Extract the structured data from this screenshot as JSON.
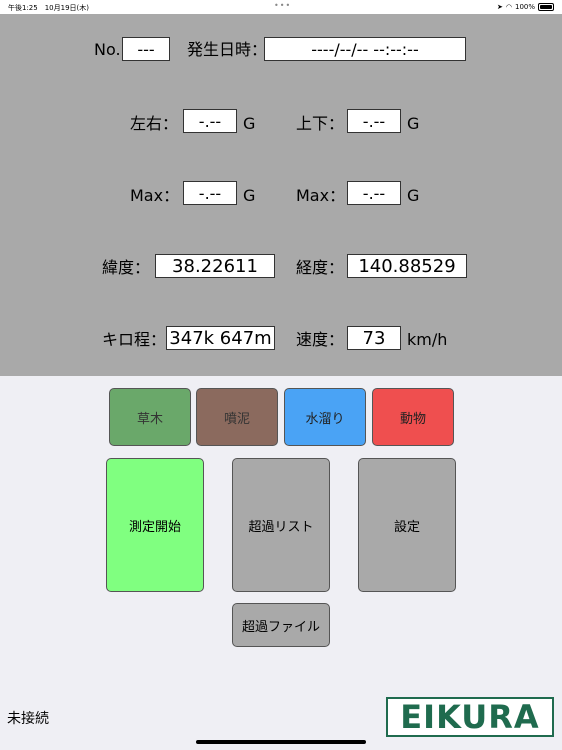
{
  "status_bar": {
    "time_date": "午後1:25　10月19日(木)",
    "dots": "•••",
    "battery": "100%"
  },
  "fields": {
    "no_label": "No.",
    "no_value": "---",
    "datetime_label": "発生日時：",
    "datetime_value": "----/--/-- --:--:--",
    "lr_label": "左右：",
    "lr_value": "-.--",
    "lr_unit": "G",
    "ud_label": "上下：",
    "ud_value": "-.--",
    "ud_unit": "G",
    "max1_label": "Max：",
    "max1_value": "-.--",
    "max1_unit": "G",
    "max2_label": "Max：",
    "max2_value": "-.--",
    "max2_unit": "G",
    "lat_label": "緯度：",
    "lat_value": "38.22611",
    "lon_label": "経度：",
    "lon_value": "140.88529",
    "km_label": "キロ程：",
    "km_value": "347k 647m",
    "speed_label": "速度：",
    "speed_value": "73",
    "speed_unit": "km/h"
  },
  "categories": [
    {
      "label": "草木",
      "color": "#6aa86a"
    },
    {
      "label": "噴泥",
      "color": "#8b6a5e"
    },
    {
      "label": "水溜り",
      "color": "#4aa3f5"
    },
    {
      "label": "動物",
      "color": "#ef4f4f"
    }
  ],
  "buttons": {
    "start": "測定開始",
    "start_color": "#80ff80",
    "excess_list": "超過リスト",
    "settings": "設定",
    "excess_file": "超過ファイル"
  },
  "connection_status": "未接続",
  "logo_text": "EIKURA"
}
